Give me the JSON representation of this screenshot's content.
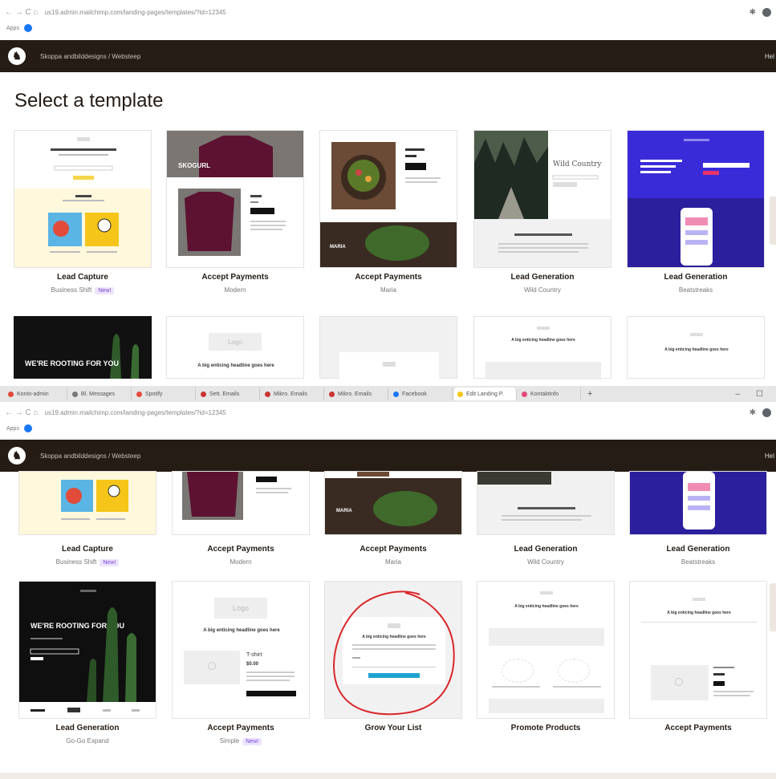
{
  "browser": {
    "nav_glyphs": "←  →  C  ⌂",
    "url": "us19.admin.mailchimp.com/landing-pages/templates/?id=12345",
    "bookmarks_label": "Apps",
    "tabs": [
      "Konto-admin",
      "Bl. Messages",
      "Spotify",
      "Sett. Emails",
      "Mikro. Emails",
      "Mikro. Emails",
      "Facebook",
      "Edit Landing P.",
      "Kontaktinfo"
    ]
  },
  "app": {
    "breadcrumb": "Skoppa andbilddesigns / Websteep",
    "help_label": "Hel"
  },
  "page": {
    "title": "Select a template"
  },
  "upper_row": [
    {
      "title": "Lead Capture",
      "subtitle": "Business Shift",
      "badge": "New!"
    },
    {
      "title": "Accept Payments",
      "subtitle": "Modern",
      "badge": ""
    },
    {
      "title": "Accept Payments",
      "subtitle": "Maria",
      "badge": ""
    },
    {
      "title": "Lead Generation",
      "subtitle": "Wild Country",
      "badge": ""
    },
    {
      "title": "Lead Generation",
      "subtitle": "Beatstreaks",
      "badge": ""
    }
  ],
  "lower_row": [
    {
      "title": "Lead Generation",
      "subtitle": "Go-Go Expand",
      "badge": ""
    },
    {
      "title": "Accept Payments",
      "subtitle": "Simple",
      "badge": "New!"
    },
    {
      "title": "Grow Your List",
      "subtitle": "",
      "badge": ""
    },
    {
      "title": "Promote Products",
      "subtitle": "",
      "badge": ""
    },
    {
      "title": "Accept Payments",
      "subtitle": "",
      "badge": ""
    }
  ],
  "thumb_text": {
    "rooting": "WE'RE ROOTING FOR YOU",
    "logo": "Logo",
    "headline": "A big enticing headline goes here",
    "wild": "Wild Country",
    "maria": "MARIA",
    "modern": "SKOGURL",
    "price_title": "T-shirt",
    "price": "$0.00"
  },
  "colors": {
    "appbar": "#241c15",
    "accent_purple": "#3a2bd8",
    "annotation_red": "#d9262b",
    "badge_bg": "#ece4ff"
  }
}
